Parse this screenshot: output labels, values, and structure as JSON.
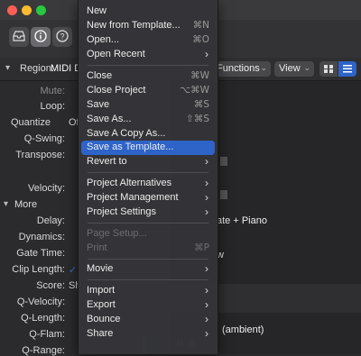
{
  "window": {
    "close_color": "#ff5f57",
    "minimize_color": "#febc2e",
    "zoom_color": "#28c840"
  },
  "toolbar": {
    "buttons": [
      {
        "icon": "inbox-icon"
      },
      {
        "icon": "info-icon"
      },
      {
        "icon": "help-icon"
      }
    ]
  },
  "region_bar": {
    "prefix": "Region:",
    "region_name": "MIDI D",
    "functions_label": "Functions",
    "view_label": "View"
  },
  "inspector": {
    "mute": "Mute:",
    "loop": "Loop:",
    "quantize": "Quantize",
    "quantize_value": "Of",
    "q_swing": "Q-Swing:",
    "transpose": "Transpose:",
    "velocity": "Velocity:",
    "more": "More",
    "delay": "Delay:",
    "dynamics": "Dynamics:",
    "gate_time": "Gate Time:",
    "clip_length": "Clip Length:",
    "score": "Score:",
    "score_value": "Sh",
    "q_velocity": "Q-Velocity:",
    "q_length": "Q-Length:",
    "q_flam": "Q-Flam:",
    "q_range": "Q-Range:"
  },
  "right": {
    "track_name_1": "ate + Piano",
    "track_name_2": "w",
    "track_name_3": "(ambient)",
    "m_label": "M",
    "s_label": "S"
  },
  "menu": {
    "new": "New",
    "new_from_template": "New from Template...",
    "new_from_template_sc": "⌘N",
    "open": "Open...",
    "open_sc": "⌘O",
    "open_recent": "Open Recent",
    "close": "Close",
    "close_sc": "⌘W",
    "close_project": "Close Project",
    "close_project_sc": "⌥⌘W",
    "save": "Save",
    "save_sc": "⌘S",
    "save_as": "Save As...",
    "save_as_sc": "⇧⌘S",
    "save_copy_as": "Save A Copy As...",
    "save_as_template": "Save as Template...",
    "revert_to": "Revert to",
    "project_alternatives": "Project Alternatives",
    "project_management": "Project Management",
    "project_settings": "Project Settings",
    "page_setup": "Page Setup...",
    "print": "Print",
    "print_sc": "⌘P",
    "movie": "Movie",
    "import": "Import",
    "export": "Export",
    "bounce": "Bounce",
    "share": "Share"
  },
  "colors": {
    "highlight": "#2e63c8",
    "checkbox": "#2f6fe0"
  }
}
